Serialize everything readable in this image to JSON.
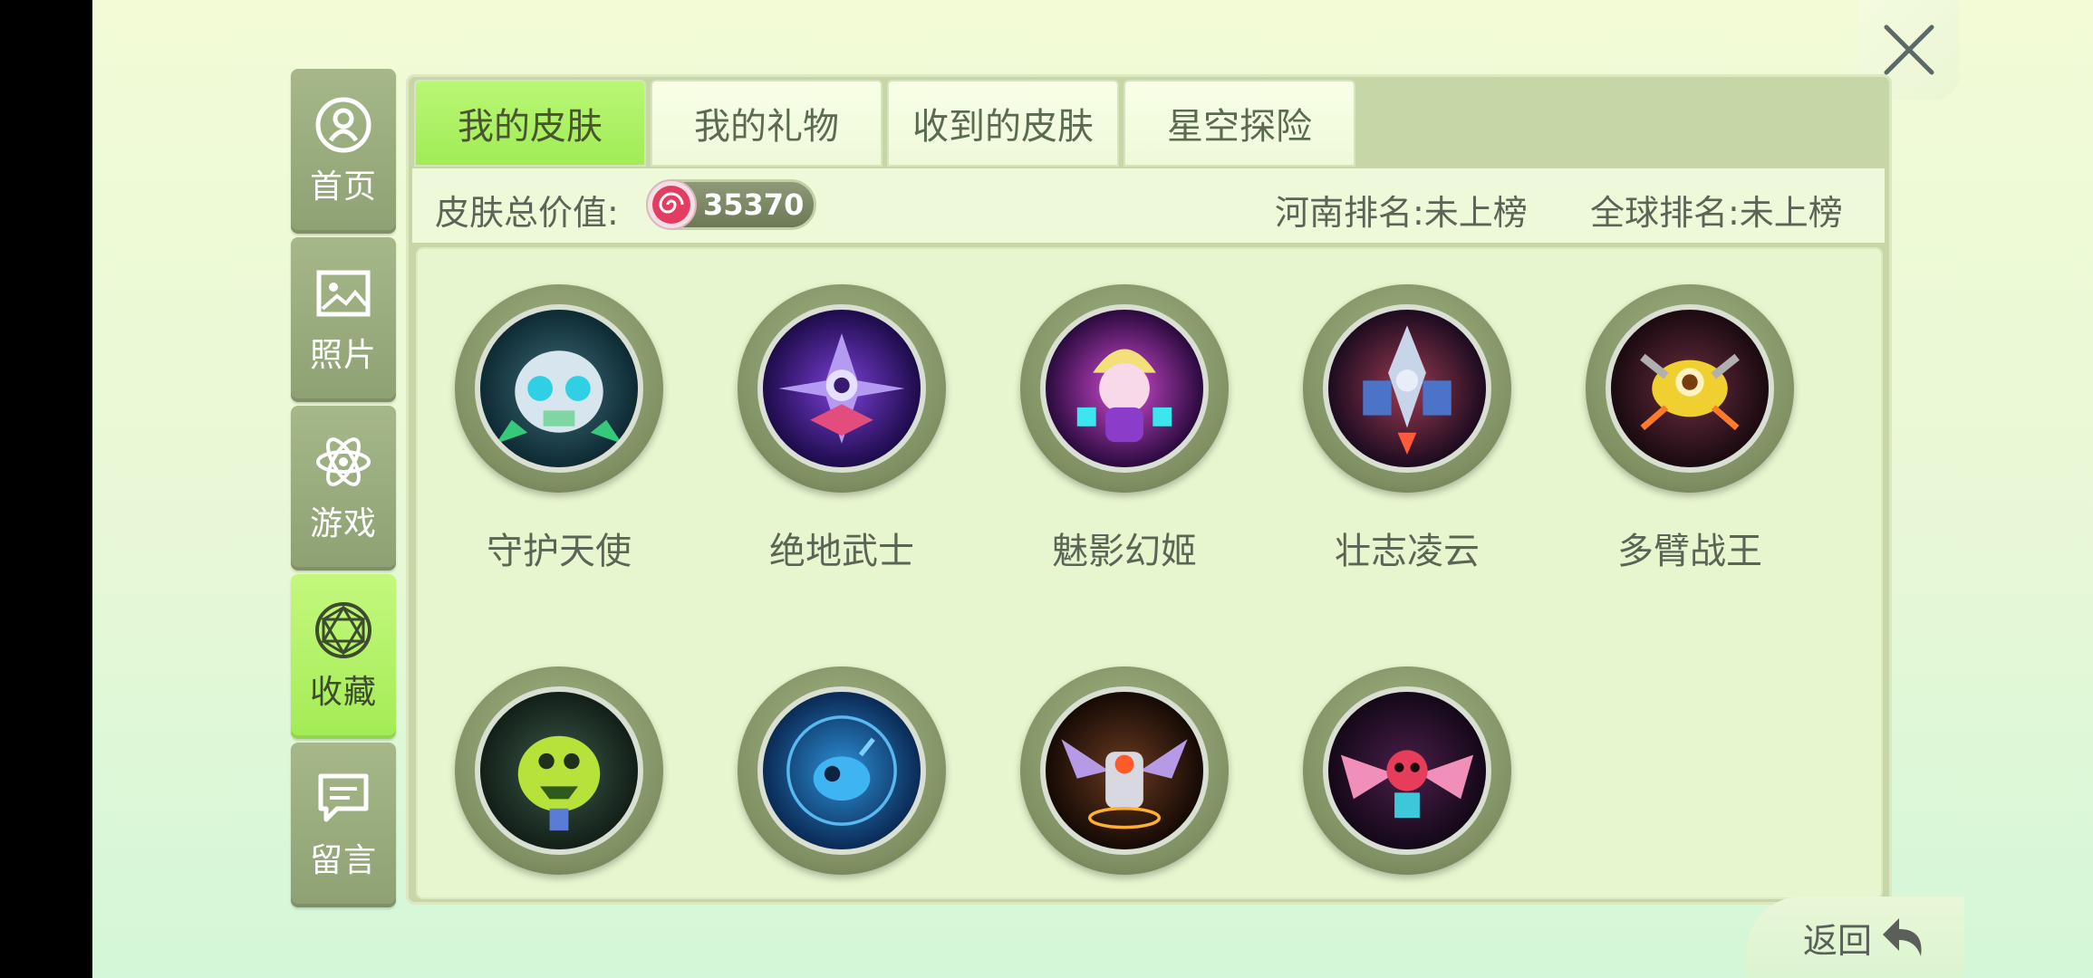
{
  "sidebar": {
    "items": [
      {
        "label": "首页",
        "icon": "profile-icon"
      },
      {
        "label": "照片",
        "icon": "photo-icon"
      },
      {
        "label": "游戏",
        "icon": "atom-icon"
      },
      {
        "label": "收藏",
        "icon": "gem-icon",
        "active": true
      },
      {
        "label": "留言",
        "icon": "message-icon"
      }
    ]
  },
  "tabs": [
    {
      "label": "我的皮肤",
      "active": true
    },
    {
      "label": "我的礼物"
    },
    {
      "label": "收到的皮肤"
    },
    {
      "label": "星空探险"
    }
  ],
  "info": {
    "total_label": "皮肤总价值:",
    "total_value": "35370",
    "henan_rank": "河南排名:未上榜",
    "global_rank": "全球排名:未上榜"
  },
  "skins": [
    {
      "name": "守护天使",
      "icon": "guardian-angel-icon"
    },
    {
      "name": "绝地武士",
      "icon": "jedi-warrior-icon"
    },
    {
      "name": "魅影幻姬",
      "icon": "phantom-princess-icon"
    },
    {
      "name": "壮志凌云",
      "icon": "soaring-ambition-icon"
    },
    {
      "name": "多臂战王",
      "icon": "multi-arm-king-icon"
    },
    {
      "icon": "green-robot-skin-icon"
    },
    {
      "icon": "blue-orb-skin-icon"
    },
    {
      "icon": "winged-knight-skin-icon"
    },
    {
      "icon": "pink-wing-skin-icon"
    }
  ],
  "footer": {
    "back_label": "返回"
  },
  "colors": {
    "accent": "#a3ec55",
    "nav_inactive": "#95a77a",
    "panel": "#c7d6a7"
  }
}
